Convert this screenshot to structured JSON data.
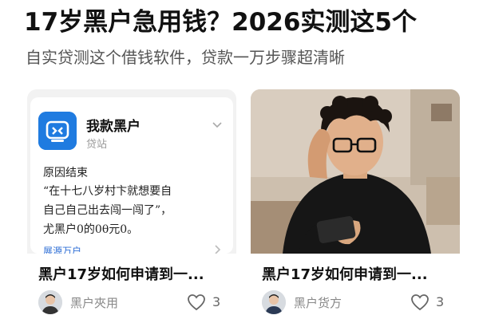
{
  "header": {
    "headline": "17岁黑户急用钱？2026实测这5个",
    "subhead": "自实贷测这个借钱软件，贷款一万步骤超清晰"
  },
  "cards": [
    {
      "app_name": "我款黑户",
      "app_subtitle": "贷站",
      "quote_title": "原因结束",
      "quote_lines": [
        "“在十七八岁村卞就想要自",
        "自己自己出去闯一闯了”，",
        "尤黑户0的0θ元0。"
      ],
      "link_text": "展源万户",
      "title": "黑户17岁如何申请到一...",
      "author": "黑户夾用",
      "likes": "3",
      "accent_color": "#1f7be0"
    },
    {
      "title": "黑户17岁如何申请到一...",
      "author": "黑户货方",
      "likes": "3"
    }
  ]
}
